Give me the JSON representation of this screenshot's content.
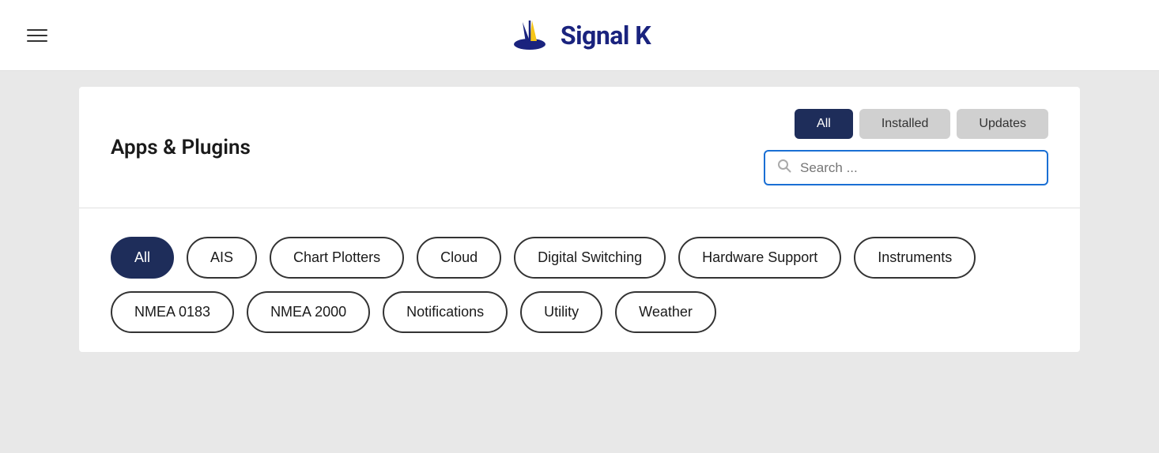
{
  "header": {
    "logo_text": "Signal K",
    "hamburger_label": "Menu"
  },
  "page": {
    "title": "Apps & Plugins"
  },
  "tabs": [
    {
      "id": "all",
      "label": "All",
      "active": true
    },
    {
      "id": "installed",
      "label": "Installed",
      "active": false
    },
    {
      "id": "updates",
      "label": "Updates",
      "active": false
    }
  ],
  "search": {
    "placeholder": "Search ..."
  },
  "categories": [
    {
      "id": "all",
      "label": "All",
      "active": true
    },
    {
      "id": "ais",
      "label": "AIS",
      "active": false
    },
    {
      "id": "chart-plotters",
      "label": "Chart Plotters",
      "active": false
    },
    {
      "id": "cloud",
      "label": "Cloud",
      "active": false
    },
    {
      "id": "digital-switching",
      "label": "Digital Switching",
      "active": false
    },
    {
      "id": "hardware-support",
      "label": "Hardware Support",
      "active": false
    },
    {
      "id": "instruments",
      "label": "Instruments",
      "active": false
    },
    {
      "id": "nmea-0183",
      "label": "NMEA 0183",
      "active": false
    },
    {
      "id": "nmea-2000",
      "label": "NMEA 2000",
      "active": false
    },
    {
      "id": "notifications",
      "label": "Notifications",
      "active": false
    },
    {
      "id": "utility",
      "label": "Utility",
      "active": false
    },
    {
      "id": "weather",
      "label": "Weather",
      "active": false
    }
  ]
}
